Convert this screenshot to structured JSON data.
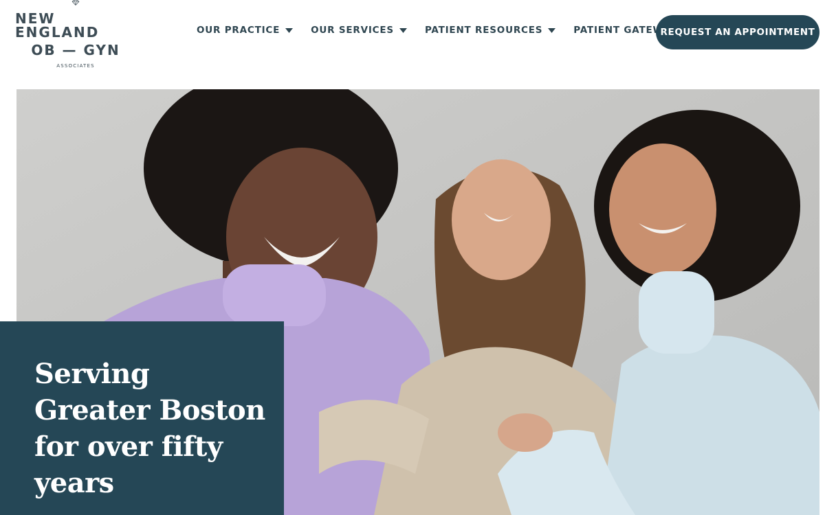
{
  "brand": {
    "line1": "NEW ENGLAND",
    "line2": "OB — GYN",
    "line3": "ASSOCIATES",
    "icon": "diamond-heart-icon"
  },
  "nav": {
    "items": [
      {
        "label": "OUR PRACTICE",
        "has_dropdown": true
      },
      {
        "label": "OUR SERVICES",
        "has_dropdown": true
      },
      {
        "label": "PATIENT RESOURCES",
        "has_dropdown": true
      },
      {
        "label": "PATIENT GATEWAY",
        "has_dropdown": false
      }
    ],
    "cta_label": "REQUEST AN APPOINTMENT"
  },
  "hero": {
    "image": "photo-three-women-laughing",
    "headline": "Serving Greater Boston for over fifty years"
  },
  "colors": {
    "primary": "#254756",
    "nav_text": "#2e4550",
    "logo": "#3d4c55",
    "background": "#ffffff"
  }
}
